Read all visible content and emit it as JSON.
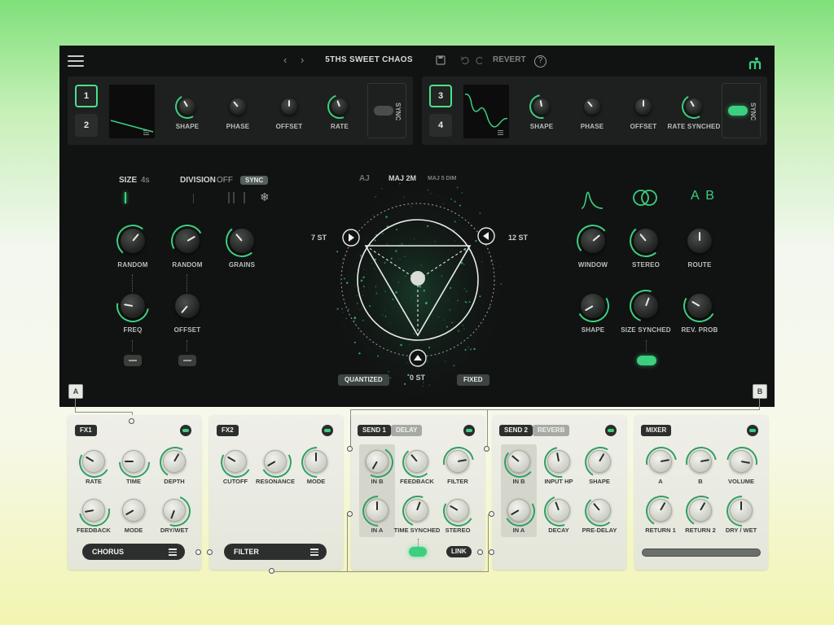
{
  "topbar": {
    "preset_name": "5THS SWEET CHAOS",
    "revert_label": "REVERT",
    "help_label": "?",
    "prev_label": "‹",
    "next_label": "›"
  },
  "lfo_left": {
    "buttons": [
      "1",
      "2"
    ],
    "knobs": [
      "SHAPE",
      "PHASE",
      "OFFSET",
      "RATE"
    ],
    "sync_label": "SYNC"
  },
  "lfo_right": {
    "buttons": [
      "3",
      "4"
    ],
    "knobs": [
      "SHAPE",
      "PHASE",
      "OFFSET",
      "RATE SYNCHED"
    ],
    "sync_label": "SYNC"
  },
  "grain": {
    "size_label": "SIZE",
    "size_value": "4s",
    "division_label": "DIVISION",
    "division_value": "OFF",
    "sync_tag": "SYNC",
    "knobs_row1": [
      "RANDOM",
      "RANDOM",
      "GRAINS"
    ],
    "knobs_row2": [
      "FREQ",
      "OFFSET"
    ]
  },
  "pitch": {
    "chord_prev": "AJ",
    "chord_current": "MAJ 2M",
    "chord_next": "MAJ 5 DIM",
    "left_label": "7 ST",
    "right_label": "12 ST",
    "bottom_label": "0 ST",
    "quantized_label": "QUANTIZED",
    "fixed_label": "FIXED"
  },
  "window": {
    "mode_labels": [
      "A B"
    ],
    "knobs_row1": [
      "WINDOW",
      "STEREO",
      "ROUTE"
    ],
    "knobs_row2": [
      "SHAPE",
      "SIZE SYNCHED",
      "REV. PROB"
    ]
  },
  "corners": {
    "a": "A",
    "b": "B"
  },
  "fx1": {
    "tag": "FX1",
    "knobs_row1": [
      "RATE",
      "TIME",
      "DEPTH"
    ],
    "knobs_row2": [
      "FEEDBACK",
      "MODE",
      "DRY/WET"
    ],
    "selector": "CHORUS"
  },
  "fx2": {
    "tag": "FX2",
    "knobs_row1": [
      "CUTOFF",
      "RESONANCE",
      "MODE"
    ],
    "selector": "FILTER"
  },
  "send1": {
    "tag": "SEND 1",
    "type": "DELAY",
    "knobs_row1": [
      "IN B",
      "FEEDBACK",
      "FILTER"
    ],
    "knobs_row2": [
      "IN A",
      "TIME SYNCHED",
      "STEREO"
    ],
    "link_label": "LINK"
  },
  "send2": {
    "tag": "SEND 2",
    "type": "REVERB",
    "knobs_row1": [
      "IN B",
      "INPUT HP",
      "SHAPE"
    ],
    "knobs_row2": [
      "IN A",
      "DECAY",
      "PRE-DELAY"
    ]
  },
  "mixer": {
    "tag": "MIXER",
    "knobs_row1": [
      "A",
      "B",
      "VOLUME"
    ],
    "knobs_row2": [
      "RETURN 1",
      "RETURN 2",
      "DRY / WET"
    ]
  },
  "colors": {
    "accent": "#3ccf80",
    "panel_dark": "#111312",
    "panel_light": "#efefe9"
  }
}
